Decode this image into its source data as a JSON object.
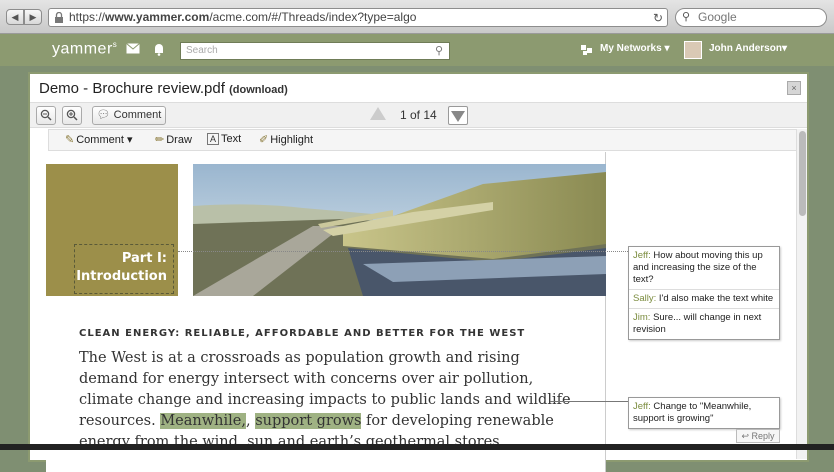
{
  "browser": {
    "url_prefix": "https://",
    "url_domain": "www.yammer.com",
    "url_path": "/acme.com/#/Threads/index?type=algo",
    "search_placeholder": "Google"
  },
  "yammer": {
    "logo": "yammer",
    "search_placeholder": "Search",
    "networks_label": "My Networks ▾",
    "user_name": "John Anderson▾"
  },
  "modal": {
    "title": "Demo - Brochure review.pdf",
    "download_label": "(download)",
    "close_glyph": "×"
  },
  "toolbar": {
    "comment_label": "Comment",
    "page_indicator": "1 of 14"
  },
  "annotation_tools": {
    "comment": "Comment",
    "draw": "Draw",
    "text": "Text",
    "highlight": "Highlight"
  },
  "document": {
    "part_line1": "Part I:",
    "part_line2": "Introduction",
    "heading": "CLEAN ENERGY: RELIABLE, AFFORDABLE AND BETTER FOR THE WEST",
    "para_a": "The West is at a crossroads as population growth and rising demand for energy intersect with concerns over air pollution, climate change and increasing impacts to public lands and wildlife resources. ",
    "highlight_1": "Meanwhile,",
    "highlight_2": "support grows",
    "para_b": " for developing renewable energy from the wind, sun and earth’s geothermal stores."
  },
  "comments": {
    "thread1": [
      {
        "author": "Jeff:",
        "text": "How about moving this up and increasing the size of the text?"
      },
      {
        "author": "Sally:",
        "text": "I'd also make the text white"
      },
      {
        "author": "Jim:",
        "text": "Sure... will change in next revision"
      }
    ],
    "thread2": [
      {
        "author": "Jeff:",
        "text": "Change to \"Meanwhile, support is growing\""
      }
    ],
    "reply_label": "Reply"
  },
  "colors": {
    "yammer_green": "#8c9a70",
    "olive": "#9c8f4a",
    "highlight": "#9fb283",
    "author": "#7b8c3e"
  }
}
